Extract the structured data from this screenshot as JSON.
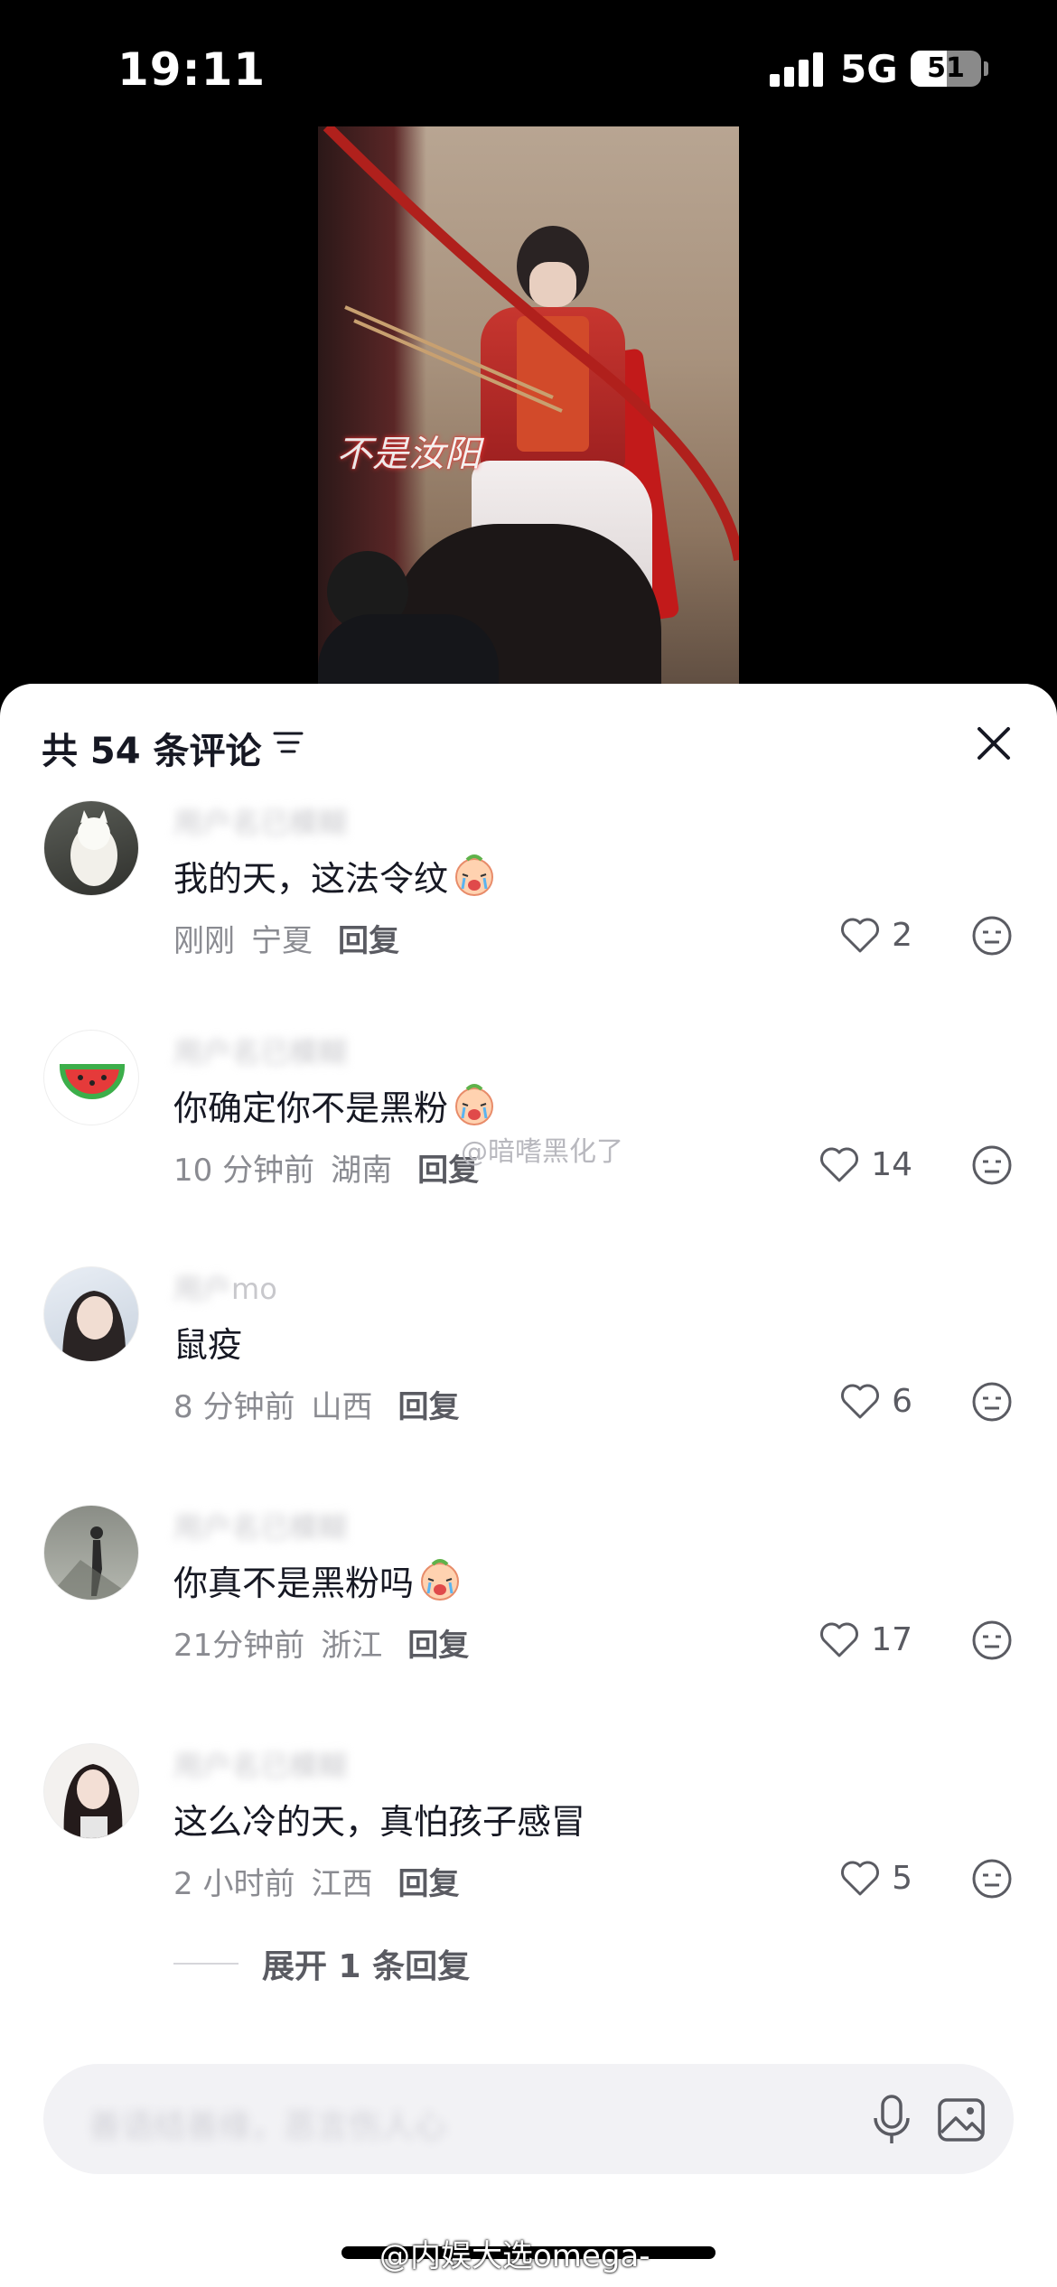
{
  "status_bar": {
    "time": "19:11",
    "network": "5G",
    "battery": "51",
    "battery_level": 0.51
  },
  "video": {
    "overlay_text": "不是汝阳"
  },
  "comments_header": {
    "title": "共 54 条评论"
  },
  "comments": [
    {
      "text": "我的天，这法令纹",
      "time": "刚刚",
      "location": "宁夏",
      "reply": "回复",
      "likes": "2"
    },
    {
      "text": "你确定你不是黑粉",
      "time": "10 分钟前",
      "location": "湖南",
      "reply": "回复",
      "likes": "14"
    },
    {
      "username_partial": "mo",
      "text": "鼠疫",
      "time": "8 分钟前",
      "location": "山西",
      "reply": "回复",
      "likes": "6"
    },
    {
      "text": "你真不是黑粉吗",
      "time": "21分钟前",
      "location": "浙江",
      "reply": "回复",
      "likes": "17"
    },
    {
      "text": "这么冷的天，真怕孩子感冒",
      "time": "2 小时前",
      "location": "江西",
      "reply": "回复",
      "likes": "5"
    }
  ],
  "expand_replies": "展开 1 条回复",
  "watermarks": {
    "middle": "@暗嗜黑化了",
    "bottom": "@内娱大选omega-"
  },
  "icons": {
    "sort": "sort-icon",
    "close": "close-icon",
    "like": "heart-icon",
    "dislike": "dislike-face-icon",
    "mic": "microphone-icon",
    "image": "image-icon"
  },
  "colors": {
    "accent_text": "#161823",
    "meta": "#8a8b91",
    "sheet_bg": "#ffffff"
  }
}
